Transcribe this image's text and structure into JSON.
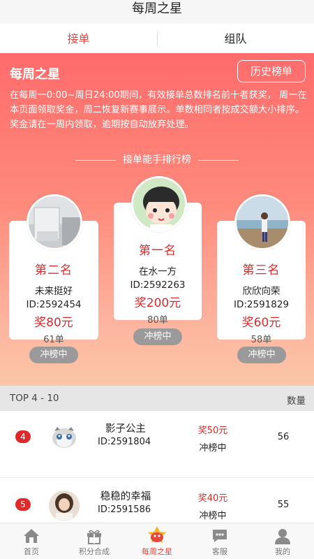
{
  "app": {
    "title": "每周之星"
  },
  "tabs": [
    {
      "label": "接单",
      "active": true
    },
    {
      "label": "组队",
      "active": false
    }
  ],
  "hero": {
    "title": "每周之星",
    "history_button": "历史榜单",
    "description": "在每周一0:00~周日24:00期间，有效接单总数排名前十者获奖， 周一在本页面领取奖金，周二恢复新赛事展示。单数相同者按成交额大小排序。 奖金请在一周内领取，逾期按自动放弃处理。",
    "rank_heading": "接单能手排行榜"
  },
  "podium": {
    "first": {
      "place": "第一名",
      "name": "在水一方",
      "id": "ID:2592263",
      "prize": "奖200元",
      "count": "80单",
      "status": "冲榜中"
    },
    "second": {
      "place": "第二名",
      "name": "未来挺好",
      "id": "ID:2592454",
      "prize": "奖80元",
      "count": "61单",
      "status": "冲榜中"
    },
    "third": {
      "place": "第三名",
      "name": "欣欣向荣",
      "id": "ID:2591829",
      "prize": "奖60元",
      "count": "58单",
      "status": "冲榜中"
    }
  },
  "list": {
    "header_left": "TOP 4 - 10",
    "header_right": "数量",
    "rows": [
      {
        "rank": "4",
        "name": "影子公主",
        "id": "ID:2591804",
        "prize": "奖50元",
        "status": "冲榜中",
        "count": "56"
      },
      {
        "rank": "5",
        "name": "稳稳的幸福",
        "id": "ID:2591586",
        "prize": "奖40元",
        "status": "冲榜中",
        "count": "55"
      }
    ]
  },
  "bottom_nav": [
    {
      "label": "首页",
      "icon": "home-icon"
    },
    {
      "label": "积分合成",
      "icon": "gift-icon"
    },
    {
      "label": "每周之星",
      "icon": "star-mascot-icon",
      "active": true
    },
    {
      "label": "客服",
      "icon": "chat-icon"
    },
    {
      "label": "我的",
      "icon": "user-icon"
    }
  ],
  "colors": {
    "accent": "#e8453c",
    "hero_top": "#ff6b6b",
    "hero_bottom": "#fcc6a8",
    "prize": "#d62d2d",
    "pill": "#9a9a9a"
  }
}
